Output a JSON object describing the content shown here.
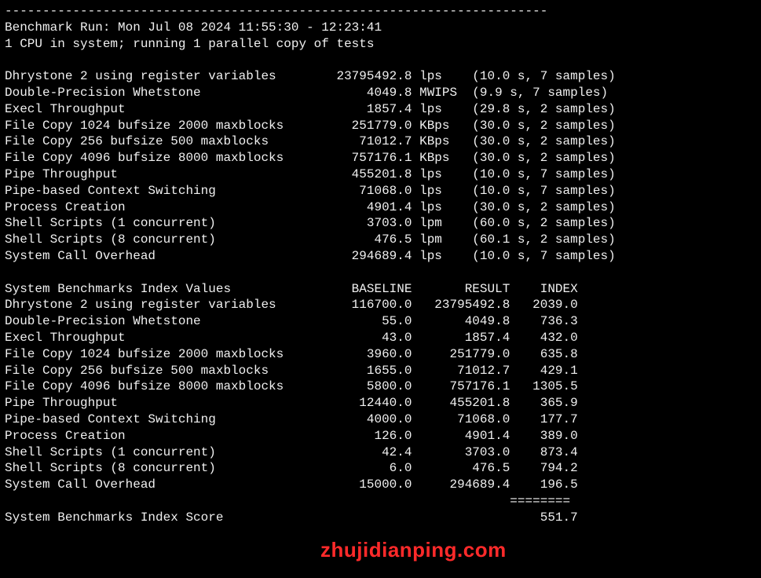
{
  "divider": "------------------------------------------------------------------------",
  "header": {
    "run_line": "Benchmark Run: Mon Jul 08 2024 11:55:30 - 12:23:41",
    "cpu_line": "1 CPU in system; running 1 parallel copy of tests"
  },
  "tests": [
    {
      "name": "Dhrystone 2 using register variables",
      "value": "23795492.8",
      "unit": "lps",
      "timing": "(10.0 s, 7 samples)"
    },
    {
      "name": "Double-Precision Whetstone",
      "value": "4049.8",
      "unit": "MWIPS",
      "timing": "(9.9 s, 7 samples)"
    },
    {
      "name": "Execl Throughput",
      "value": "1857.4",
      "unit": "lps",
      "timing": "(29.8 s, 2 samples)"
    },
    {
      "name": "File Copy 1024 bufsize 2000 maxblocks",
      "value": "251779.0",
      "unit": "KBps",
      "timing": "(30.0 s, 2 samples)"
    },
    {
      "name": "File Copy 256 bufsize 500 maxblocks",
      "value": "71012.7",
      "unit": "KBps",
      "timing": "(30.0 s, 2 samples)"
    },
    {
      "name": "File Copy 4096 bufsize 8000 maxblocks",
      "value": "757176.1",
      "unit": "KBps",
      "timing": "(30.0 s, 2 samples)"
    },
    {
      "name": "Pipe Throughput",
      "value": "455201.8",
      "unit": "lps",
      "timing": "(10.0 s, 7 samples)"
    },
    {
      "name": "Pipe-based Context Switching",
      "value": "71068.0",
      "unit": "lps",
      "timing": "(10.0 s, 7 samples)"
    },
    {
      "name": "Process Creation",
      "value": "4901.4",
      "unit": "lps",
      "timing": "(30.0 s, 2 samples)"
    },
    {
      "name": "Shell Scripts (1 concurrent)",
      "value": "3703.0",
      "unit": "lpm",
      "timing": "(60.0 s, 2 samples)"
    },
    {
      "name": "Shell Scripts (8 concurrent)",
      "value": "476.5",
      "unit": "lpm",
      "timing": "(60.1 s, 2 samples)"
    },
    {
      "name": "System Call Overhead",
      "value": "294689.4",
      "unit": "lps",
      "timing": "(10.0 s, 7 samples)"
    }
  ],
  "index_header": {
    "title": "System Benchmarks Index Values",
    "col_baseline": "BASELINE",
    "col_result": "RESULT",
    "col_index": "INDEX"
  },
  "indices": [
    {
      "name": "Dhrystone 2 using register variables",
      "baseline": "116700.0",
      "result": "23795492.8",
      "index": "2039.0"
    },
    {
      "name": "Double-Precision Whetstone",
      "baseline": "55.0",
      "result": "4049.8",
      "index": "736.3"
    },
    {
      "name": "Execl Throughput",
      "baseline": "43.0",
      "result": "1857.4",
      "index": "432.0"
    },
    {
      "name": "File Copy 1024 bufsize 2000 maxblocks",
      "baseline": "3960.0",
      "result": "251779.0",
      "index": "635.8"
    },
    {
      "name": "File Copy 256 bufsize 500 maxblocks",
      "baseline": "1655.0",
      "result": "71012.7",
      "index": "429.1"
    },
    {
      "name": "File Copy 4096 bufsize 8000 maxblocks",
      "baseline": "5800.0",
      "result": "757176.1",
      "index": "1305.5"
    },
    {
      "name": "Pipe Throughput",
      "baseline": "12440.0",
      "result": "455201.8",
      "index": "365.9"
    },
    {
      "name": "Pipe-based Context Switching",
      "baseline": "4000.0",
      "result": "71068.0",
      "index": "177.7"
    },
    {
      "name": "Process Creation",
      "baseline": "126.0",
      "result": "4901.4",
      "index": "389.0"
    },
    {
      "name": "Shell Scripts (1 concurrent)",
      "baseline": "42.4",
      "result": "3703.0",
      "index": "873.4"
    },
    {
      "name": "Shell Scripts (8 concurrent)",
      "baseline": "6.0",
      "result": "476.5",
      "index": "794.2"
    },
    {
      "name": "System Call Overhead",
      "baseline": "15000.0",
      "result": "294689.4",
      "index": "196.5"
    }
  ],
  "score_divider": "                                                                   ========",
  "score": {
    "label": "System Benchmarks Index Score",
    "value": "551.7"
  },
  "watermark": "zhujidianping.com"
}
